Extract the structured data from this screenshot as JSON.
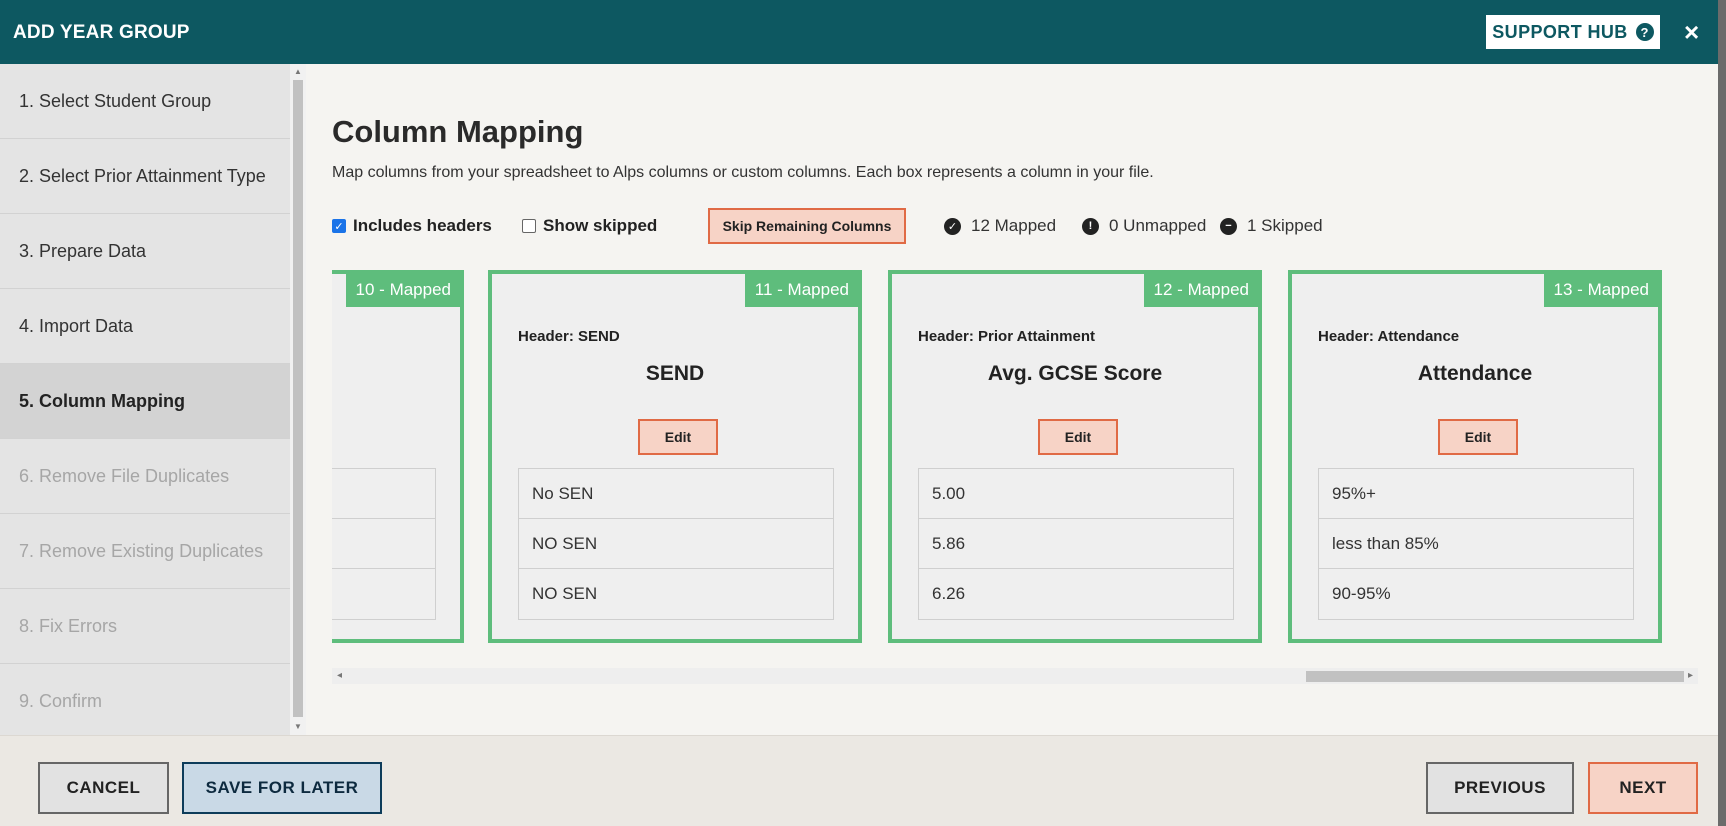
{
  "header": {
    "title": "ADD YEAR GROUP",
    "support_label": "SUPPORT HUB",
    "support_icon": "question-circle-icon",
    "close_icon": "×"
  },
  "sidebar": {
    "steps": [
      {
        "label": "1. Select Student Group",
        "state": "complete"
      },
      {
        "label": "2. Select Prior Attainment Type",
        "state": "complete"
      },
      {
        "label": "3. Prepare Data",
        "state": "complete"
      },
      {
        "label": "4. Import Data",
        "state": "complete"
      },
      {
        "label": "5. Column Mapping",
        "state": "active"
      },
      {
        "label": "6. Remove File Duplicates",
        "state": "disabled"
      },
      {
        "label": "7. Remove Existing Duplicates",
        "state": "disabled"
      },
      {
        "label": "8. Fix Errors",
        "state": "disabled"
      },
      {
        "label": "9. Confirm",
        "state": "disabled"
      }
    ]
  },
  "main": {
    "title": "Column Mapping",
    "description": "Map columns from your spreadsheet to Alps columns or custom columns. Each box represents a column in your file.",
    "toolbar": {
      "includes_headers_label": "Includes headers",
      "includes_headers_checked": true,
      "show_skipped_label": "Show skipped",
      "show_skipped_checked": false,
      "skip_remaining_label": "Skip Remaining Columns",
      "mapped_text": "12 Mapped",
      "unmapped_text": "0 Unmapped",
      "skipped_text": "1 Skipped"
    },
    "cards": [
      {
        "badge": "10 - Mapped",
        "header": "",
        "title": "",
        "edit_label": "",
        "samples": [
          "",
          "",
          ""
        ]
      },
      {
        "badge": "11 - Mapped",
        "header": "Header: SEND",
        "title": "SEND",
        "edit_label": "Edit",
        "samples": [
          "No SEN",
          "NO SEN",
          "NO SEN"
        ]
      },
      {
        "badge": "12 - Mapped",
        "header": "Header: Prior Attainment",
        "title": "Avg. GCSE Score",
        "edit_label": "Edit",
        "samples": [
          "5.00",
          "5.86",
          "6.26"
        ]
      },
      {
        "badge": "13 - Mapped",
        "header": "Header: Attendance",
        "title": "Attendance",
        "edit_label": "Edit",
        "samples": [
          "95%+",
          "less than 85%",
          "90-95%"
        ]
      }
    ]
  },
  "footer": {
    "cancel_label": "CANCEL",
    "save_label": "SAVE FOR LATER",
    "previous_label": "PREVIOUS",
    "next_label": "NEXT"
  },
  "colors": {
    "header_bg": "#0d5861",
    "mapped_green": "#5ebd7c",
    "accent_orange": "#e06a45",
    "accent_orange_bg": "#f7d3c6"
  }
}
